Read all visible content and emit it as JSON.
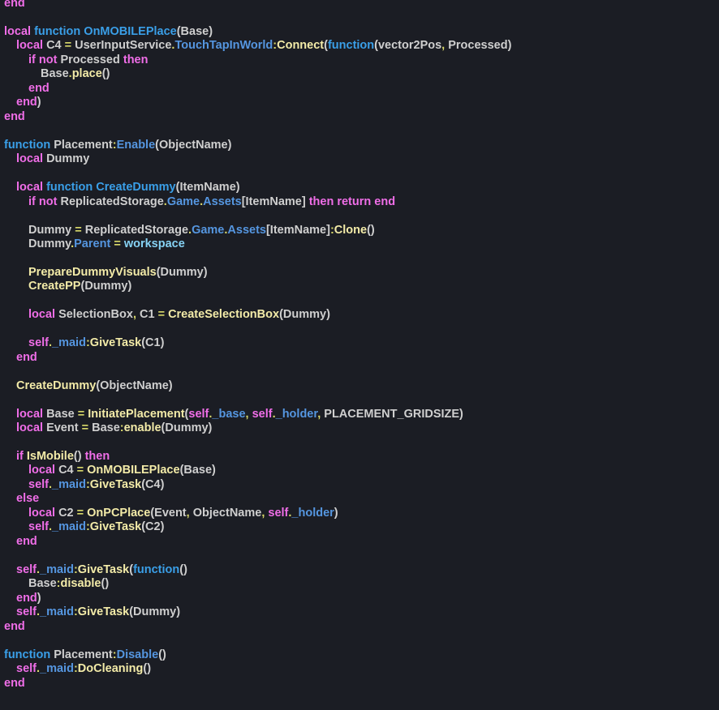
{
  "colors": {
    "background": "#1b1d24",
    "keyword": "#f06ee8",
    "function_keyword": "#3a9fe8",
    "property": "#5596e0",
    "method": "#f3eba8",
    "operator": "#d8d86a",
    "builtin": "#86d2f4",
    "text": "#cfcfcf"
  },
  "lines": [
    {
      "indent": 0,
      "tokens": [
        [
          "k",
          "end"
        ]
      ]
    },
    {
      "indent": 0,
      "tokens": []
    },
    {
      "indent": 0,
      "tokens": [
        [
          "k",
          "local"
        ],
        [
          "t",
          " "
        ],
        [
          "f",
          "function"
        ],
        [
          "t",
          " "
        ],
        [
          "n",
          "OnMOBILEPlace"
        ],
        [
          "t",
          "(Base)"
        ]
      ]
    },
    {
      "indent": 1,
      "tokens": [
        [
          "k",
          "local"
        ],
        [
          "t",
          " C4 "
        ],
        [
          "o",
          "="
        ],
        [
          "t",
          " UserInputService"
        ],
        [
          "o",
          "."
        ],
        [
          "p",
          "TouchTapInWorld"
        ],
        [
          "o",
          ":"
        ],
        [
          "m",
          "Connect"
        ],
        [
          "t",
          "("
        ],
        [
          "f",
          "function"
        ],
        [
          "t",
          "(vector2Pos"
        ],
        [
          "o",
          ","
        ],
        [
          "t",
          " Processed)"
        ]
      ]
    },
    {
      "indent": 2,
      "tokens": [
        [
          "k",
          "if not"
        ],
        [
          "t",
          " Processed "
        ],
        [
          "k",
          "then"
        ]
      ]
    },
    {
      "indent": 3,
      "tokens": [
        [
          "t",
          "Base"
        ],
        [
          "o",
          "."
        ],
        [
          "m",
          "place"
        ],
        [
          "t",
          "()"
        ]
      ]
    },
    {
      "indent": 2,
      "tokens": [
        [
          "k",
          "end"
        ]
      ]
    },
    {
      "indent": 1,
      "tokens": [
        [
          "k",
          "end"
        ],
        [
          "t",
          ")"
        ]
      ]
    },
    {
      "indent": 0,
      "tokens": [
        [
          "k",
          "end"
        ]
      ]
    },
    {
      "indent": 0,
      "tokens": []
    },
    {
      "indent": 0,
      "tokens": [
        [
          "f",
          "function"
        ],
        [
          "t",
          " Placement"
        ],
        [
          "o",
          ":"
        ],
        [
          "p",
          "Enable"
        ],
        [
          "t",
          "(ObjectName)"
        ]
      ]
    },
    {
      "indent": 1,
      "tokens": [
        [
          "k",
          "local"
        ],
        [
          "t",
          " Dummy"
        ]
      ]
    },
    {
      "indent": 0,
      "tokens": []
    },
    {
      "indent": 1,
      "tokens": [
        [
          "k",
          "local"
        ],
        [
          "t",
          " "
        ],
        [
          "f",
          "function"
        ],
        [
          "t",
          " "
        ],
        [
          "n",
          "CreateDummy"
        ],
        [
          "t",
          "(ItemName)"
        ]
      ]
    },
    {
      "indent": 2,
      "tokens": [
        [
          "k",
          "if not"
        ],
        [
          "t",
          " ReplicatedStorage"
        ],
        [
          "o",
          "."
        ],
        [
          "p",
          "Game"
        ],
        [
          "o",
          "."
        ],
        [
          "p",
          "Assets"
        ],
        [
          "t",
          "[ItemName] "
        ],
        [
          "k",
          "then return end"
        ]
      ]
    },
    {
      "indent": 0,
      "tokens": []
    },
    {
      "indent": 2,
      "tokens": [
        [
          "t",
          "Dummy "
        ],
        [
          "o",
          "="
        ],
        [
          "t",
          " ReplicatedStorage"
        ],
        [
          "o",
          "."
        ],
        [
          "p",
          "Game"
        ],
        [
          "o",
          "."
        ],
        [
          "p",
          "Assets"
        ],
        [
          "t",
          "[ItemName]"
        ],
        [
          "o",
          ":"
        ],
        [
          "m",
          "Clone"
        ],
        [
          "t",
          "()"
        ]
      ]
    },
    {
      "indent": 2,
      "tokens": [
        [
          "t",
          "Dummy"
        ],
        [
          "o",
          "."
        ],
        [
          "p",
          "Parent"
        ],
        [
          "t",
          " "
        ],
        [
          "o",
          "="
        ],
        [
          "t",
          " "
        ],
        [
          "b",
          "workspace"
        ]
      ]
    },
    {
      "indent": 0,
      "tokens": []
    },
    {
      "indent": 2,
      "tokens": [
        [
          "m",
          "PrepareDummyVisuals"
        ],
        [
          "t",
          "(Dummy)"
        ]
      ]
    },
    {
      "indent": 2,
      "tokens": [
        [
          "m",
          "CreatePP"
        ],
        [
          "t",
          "(Dummy)"
        ]
      ]
    },
    {
      "indent": 0,
      "tokens": []
    },
    {
      "indent": 2,
      "tokens": [
        [
          "k",
          "local"
        ],
        [
          "t",
          " SelectionBox"
        ],
        [
          "o",
          ","
        ],
        [
          "t",
          " C1 "
        ],
        [
          "o",
          "="
        ],
        [
          "t",
          " "
        ],
        [
          "m",
          "CreateSelectionBox"
        ],
        [
          "t",
          "(Dummy)"
        ]
      ]
    },
    {
      "indent": 0,
      "tokens": []
    },
    {
      "indent": 2,
      "tokens": [
        [
          "k",
          "self"
        ],
        [
          "o",
          "."
        ],
        [
          "p",
          "_maid"
        ],
        [
          "o",
          ":"
        ],
        [
          "m",
          "GiveTask"
        ],
        [
          "t",
          "(C1)"
        ]
      ]
    },
    {
      "indent": 1,
      "tokens": [
        [
          "k",
          "end"
        ]
      ]
    },
    {
      "indent": 0,
      "tokens": []
    },
    {
      "indent": 1,
      "tokens": [
        [
          "m",
          "CreateDummy"
        ],
        [
          "t",
          "(ObjectName)"
        ]
      ]
    },
    {
      "indent": 0,
      "tokens": []
    },
    {
      "indent": 1,
      "tokens": [
        [
          "k",
          "local"
        ],
        [
          "t",
          " Base "
        ],
        [
          "o",
          "="
        ],
        [
          "t",
          " "
        ],
        [
          "m",
          "InitiatePlacement"
        ],
        [
          "t",
          "("
        ],
        [
          "k",
          "self"
        ],
        [
          "o",
          "."
        ],
        [
          "p",
          "_base"
        ],
        [
          "o",
          ","
        ],
        [
          "t",
          " "
        ],
        [
          "k",
          "self"
        ],
        [
          "o",
          "."
        ],
        [
          "p",
          "_holder"
        ],
        [
          "o",
          ","
        ],
        [
          "t",
          " PLACEMENT_GRIDSIZE)"
        ]
      ]
    },
    {
      "indent": 1,
      "tokens": [
        [
          "k",
          "local"
        ],
        [
          "t",
          " Event "
        ],
        [
          "o",
          "="
        ],
        [
          "t",
          " Base"
        ],
        [
          "o",
          ":"
        ],
        [
          "m",
          "enable"
        ],
        [
          "t",
          "(Dummy)"
        ]
      ]
    },
    {
      "indent": 0,
      "tokens": []
    },
    {
      "indent": 1,
      "tokens": [
        [
          "k",
          "if"
        ],
        [
          "t",
          " "
        ],
        [
          "m",
          "IsMobile"
        ],
        [
          "t",
          "() "
        ],
        [
          "k",
          "then"
        ]
      ]
    },
    {
      "indent": 2,
      "tokens": [
        [
          "k",
          "local"
        ],
        [
          "t",
          " C4 "
        ],
        [
          "o",
          "="
        ],
        [
          "t",
          " "
        ],
        [
          "m",
          "OnMOBILEPlace"
        ],
        [
          "t",
          "(Base)"
        ]
      ]
    },
    {
      "indent": 2,
      "tokens": [
        [
          "k",
          "self"
        ],
        [
          "o",
          "."
        ],
        [
          "p",
          "_maid"
        ],
        [
          "o",
          ":"
        ],
        [
          "m",
          "GiveTask"
        ],
        [
          "t",
          "(C4)"
        ]
      ]
    },
    {
      "indent": 1,
      "tokens": [
        [
          "k",
          "else"
        ]
      ]
    },
    {
      "indent": 2,
      "tokens": [
        [
          "k",
          "local"
        ],
        [
          "t",
          " C2 "
        ],
        [
          "o",
          "="
        ],
        [
          "t",
          " "
        ],
        [
          "m",
          "OnPCPlace"
        ],
        [
          "t",
          "(Event"
        ],
        [
          "o",
          ","
        ],
        [
          "t",
          " ObjectName"
        ],
        [
          "o",
          ","
        ],
        [
          "t",
          " "
        ],
        [
          "k",
          "self"
        ],
        [
          "o",
          "."
        ],
        [
          "p",
          "_holder"
        ],
        [
          "t",
          ")"
        ]
      ]
    },
    {
      "indent": 2,
      "tokens": [
        [
          "k",
          "self"
        ],
        [
          "o",
          "."
        ],
        [
          "p",
          "_maid"
        ],
        [
          "o",
          ":"
        ],
        [
          "m",
          "GiveTask"
        ],
        [
          "t",
          "(C2)"
        ]
      ]
    },
    {
      "indent": 1,
      "tokens": [
        [
          "k",
          "end"
        ]
      ]
    },
    {
      "indent": 0,
      "tokens": []
    },
    {
      "indent": 1,
      "tokens": [
        [
          "k",
          "self"
        ],
        [
          "o",
          "."
        ],
        [
          "p",
          "_maid"
        ],
        [
          "o",
          ":"
        ],
        [
          "m",
          "GiveTask"
        ],
        [
          "t",
          "("
        ],
        [
          "f",
          "function"
        ],
        [
          "t",
          "()"
        ]
      ]
    },
    {
      "indent": 2,
      "tokens": [
        [
          "t",
          "Base"
        ],
        [
          "o",
          ":"
        ],
        [
          "m",
          "disable"
        ],
        [
          "t",
          "()"
        ]
      ]
    },
    {
      "indent": 1,
      "tokens": [
        [
          "k",
          "end"
        ],
        [
          "t",
          ")"
        ]
      ]
    },
    {
      "indent": 1,
      "tokens": [
        [
          "k",
          "self"
        ],
        [
          "o",
          "."
        ],
        [
          "p",
          "_maid"
        ],
        [
          "o",
          ":"
        ],
        [
          "m",
          "GiveTask"
        ],
        [
          "t",
          "(Dummy)"
        ]
      ]
    },
    {
      "indent": 0,
      "tokens": [
        [
          "k",
          "end"
        ]
      ]
    },
    {
      "indent": 0,
      "tokens": []
    },
    {
      "indent": 0,
      "tokens": [
        [
          "f",
          "function"
        ],
        [
          "t",
          " Placement"
        ],
        [
          "o",
          ":"
        ],
        [
          "p",
          "Disable"
        ],
        [
          "t",
          "()"
        ]
      ]
    },
    {
      "indent": 1,
      "tokens": [
        [
          "k",
          "self"
        ],
        [
          "o",
          "."
        ],
        [
          "p",
          "_maid"
        ],
        [
          "o",
          ":"
        ],
        [
          "m",
          "DoCleaning"
        ],
        [
          "t",
          "()"
        ]
      ]
    },
    {
      "indent": 0,
      "tokens": [
        [
          "k",
          "end"
        ]
      ]
    }
  ]
}
